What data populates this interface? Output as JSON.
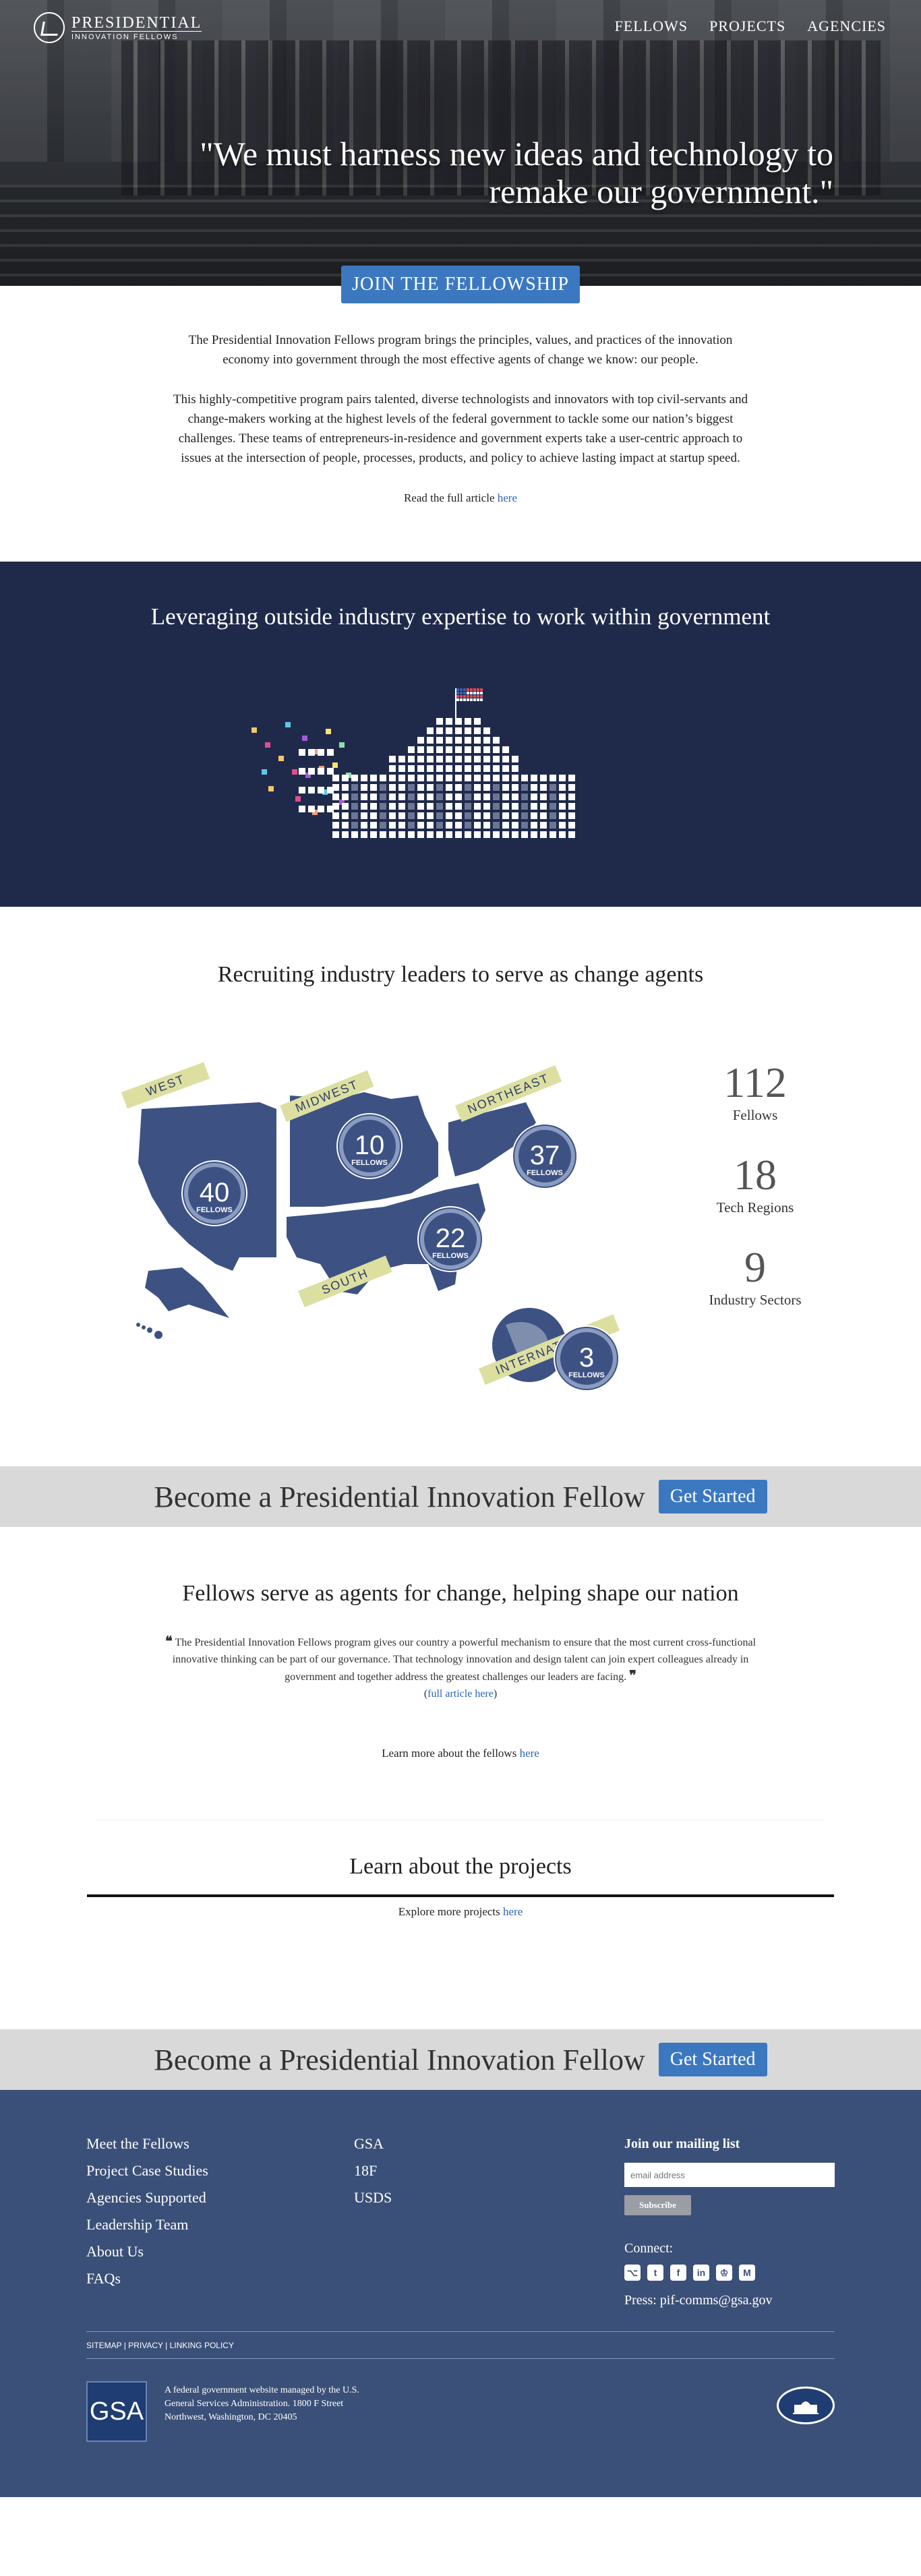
{
  "header": {
    "logo_line1": "PRESIDENTIAL",
    "logo_line2": "INNOVATION FELLOWS",
    "nav": [
      "FELLOWS",
      "PROJECTS",
      "AGENCIES"
    ]
  },
  "hero": {
    "quote": "\"We must harness new ideas and technology to remake our government.\""
  },
  "join_button": "JOIN THE FELLOWSHIP",
  "intro": {
    "p1": "The Presidential Innovation Fellows program brings the principles, values, and practices of the innovation economy into government through the most effective agents of change we know: our people.",
    "p2": "This highly-competitive program pairs talented, diverse technologists and innovators with top civil-servants and change-makers working at the highest levels of the federal government to tackle some our nation’s biggest challenges. These teams of entrepreneurs-in-residence and government experts take a user-centric approach to issues at the intersection of people, processes, products, and policy to achieve lasting impact at startup speed.",
    "read_prefix": "Read the full article ",
    "read_link": "here"
  },
  "leverage": {
    "title": "Leveraging outside industry expertise to work within government"
  },
  "recruit": {
    "title": "Recruiting industry leaders to serve as change agents",
    "regions": [
      {
        "name": "WEST",
        "count": "40"
      },
      {
        "name": "MIDWEST",
        "count": "10"
      },
      {
        "name": "NORTHEAST",
        "count": "37"
      },
      {
        "name": "SOUTH",
        "count": "22"
      },
      {
        "name": "INTERNATIONAL",
        "count": "3"
      }
    ],
    "badge_label": "FELLOWS",
    "stats": [
      {
        "num": "112",
        "label": "Fellows"
      },
      {
        "num": "18",
        "label": "Tech Regions"
      },
      {
        "num": "9",
        "label": "Industry Sectors"
      }
    ]
  },
  "cta": {
    "text": "Become a Presidential Innovation Fellow",
    "button": "Get Started"
  },
  "fellows": {
    "title": "Fellows serve as agents for change, helping shape our nation",
    "quote": "The Presidential Innovation Fellows program gives our country a powerful mechanism to ensure that the most current cross-functional innovative thinking can be part of our governance. That technology innovation and design talent can join expert colleagues already in government and together address the greatest challenges our leaders are facing.",
    "article_link": "full article here",
    "more_prefix": "Learn more about the fellows ",
    "more_link": "here"
  },
  "projects": {
    "title": "Learn about the projects",
    "explore_prefix": "Explore more projects ",
    "explore_link": "here"
  },
  "footer": {
    "col1": [
      "Meet the Fellows",
      "Project Case Studies",
      "Agencies Supported",
      "Leadership Team",
      "About Us",
      "FAQs"
    ],
    "col2": [
      "GSA",
      "18F",
      "USDS"
    ],
    "mailing_heading": "Join our mailing list",
    "email_placeholder": "email address",
    "subscribe": "Subscribe",
    "connect": "Connect:",
    "press": "Press: pif-comms@gsa.gov",
    "legal": "SITEMAP | PRIVACY | LINKING POLICY",
    "gsa_logo": "GSA",
    "gsa_line1": "A federal government website managed by the U.S.",
    "gsa_line2": "General Services Administration. 1800 F Street",
    "gsa_line3": "Northwest, Washington, DC 20405"
  },
  "colors": {
    "accent": "#3b78c0",
    "navy": "#1f2a4b",
    "map_blue": "#3d5283",
    "banner_yellow": "#dcdfa0",
    "footer": "#3b5078"
  },
  "icons": [
    "github-icon",
    "twitter-icon",
    "facebook-icon",
    "linkedin-icon",
    "challenge-post-icon",
    "medium-icon"
  ]
}
